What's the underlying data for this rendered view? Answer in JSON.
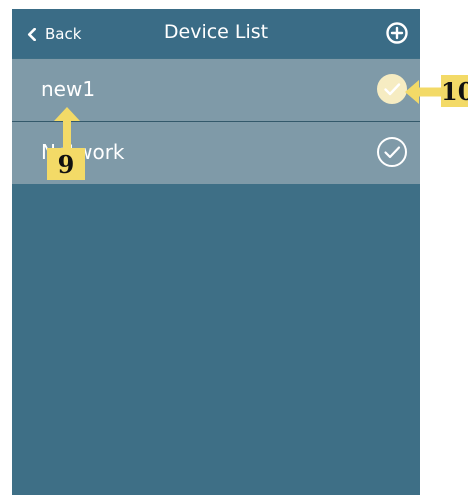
{
  "header": {
    "back_label": "Back",
    "title": "Device List",
    "add_icon": "plus-circle-icon"
  },
  "devices": [
    {
      "name": "new1",
      "status_icon": "check-circle-icon",
      "selected": true
    },
    {
      "name": "Network",
      "status_icon": "check-circle-icon",
      "selected": false
    }
  ],
  "annotations": [
    {
      "label": "9"
    },
    {
      "label": "10"
    }
  ],
  "colors": {
    "header_bg": "#3a6c86",
    "content_bg": "#3e6f86",
    "row_bg": "#7f9aa8",
    "annotation_yellow": "#f3da67"
  }
}
